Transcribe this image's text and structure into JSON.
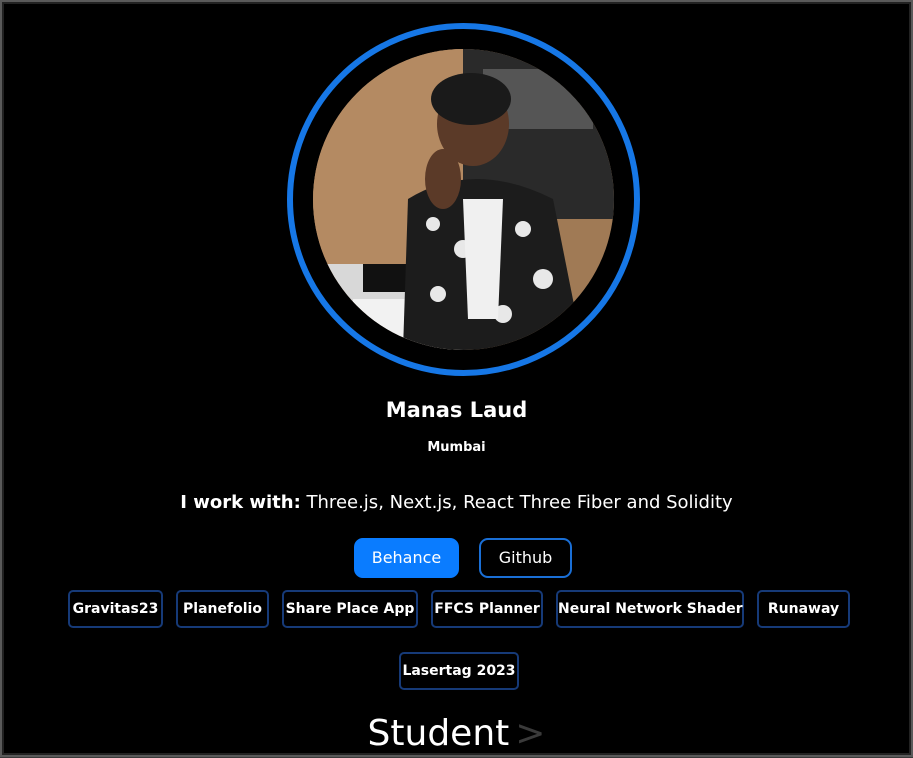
{
  "profile": {
    "name": "Manas Laud",
    "location": "Mumbai",
    "avatar_alt": "profile-photo"
  },
  "work": {
    "label": "I work with:",
    "text": "Three.js, Next.js, React Three Fiber and Solidity"
  },
  "links": {
    "behance": "Behance",
    "github": "Github"
  },
  "projects": [
    "Gravitas23",
    "Planefolio",
    "Share Place App",
    "FFCS Planner",
    "Neural Network Shader",
    "Runaway",
    "Lasertag 2023"
  ],
  "role": {
    "text": "Student",
    "cursor": ">"
  },
  "colors": {
    "background": "#000000",
    "accent": "#0a7cff",
    "ring": "#1677e6",
    "project_border": "#163a78"
  }
}
